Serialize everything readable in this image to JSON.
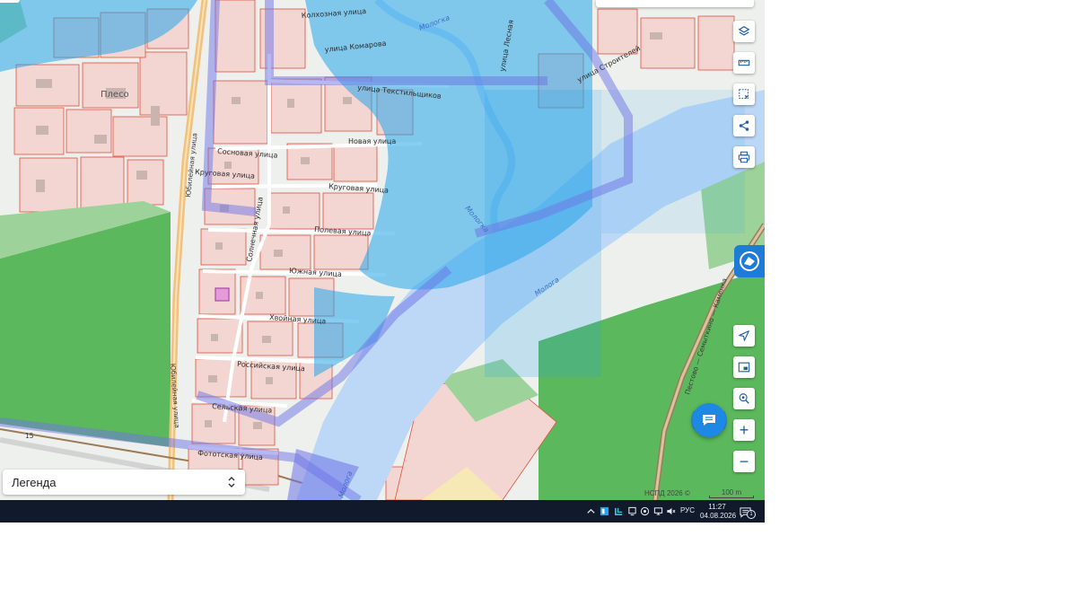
{
  "map": {
    "labels": {
      "town": "Плесо",
      "komarova": "улица Комарова",
      "tekstilshchikov": "улица Текстильщиков",
      "kolkhoznaya": "Колхозная улица",
      "stroiteley": "улица Строителей",
      "lesnaya": "улица Лесная",
      "novaya": "Новая улица",
      "sosnovaya": "Сосновая улица",
      "krugovaya_west": "Круговая улица",
      "krugovaya_east": "Круговая улица",
      "yubileynaya_north": "Юбилейная улица",
      "yubileynaya_south": "Юбилейная улица",
      "solnechnaya": "Солнечная улица",
      "polevaya": "Полевая улица",
      "yuzhnaya": "Южная улица",
      "khvoynaya": "Хвойная улица",
      "rossiyskaya": "Российская улица",
      "selskaya": "Сельская улица",
      "fototskaya": "Фототская улица",
      "mologa_center": "Молога",
      "mologa_south": "Молога",
      "molojka_north": "Мологка",
      "molojka_mid": "Мологка",
      "road_east": "Пестово — Семыткино — Каменка",
      "road_number": "15"
    },
    "colors": {
      "background": "#eef0ee",
      "parcel_fill": "#f3d6d2",
      "parcel_stroke": "#e0503a",
      "green": "#5cb85c",
      "light_green": "#9dd39a",
      "water": "#bdd7f7",
      "flood_blue": "#25a6ea",
      "protection_purple": "#6e73e6",
      "road": "#ffffff",
      "federal_road": "#f3c27a",
      "rail": "#9c7b57"
    }
  },
  "controls": {
    "layers": "layers-icon",
    "ruler": "ruler-icon",
    "select_area": "select-area-icon",
    "share": "share-icon",
    "print": "printer-icon",
    "locate": "locate-arrow-icon",
    "minimap": "minimap-icon",
    "geo_search": "geo-search-icon",
    "zoom_in": "+",
    "zoom_out": "−",
    "chat": "chat-icon",
    "logo": "nspd-logo-icon"
  },
  "legend": {
    "label": "Легенда"
  },
  "attribution": "НСПД 2026 ©",
  "scale": {
    "label": "100 m"
  },
  "taskbar": {
    "language": "РУС",
    "time": "11:27",
    "date": "04.08.2026",
    "notifications": "1",
    "tray_icons": [
      "chevron-up-icon",
      "cloud-app-icon",
      "vpn-icon",
      "display-icon",
      "wifi-icon",
      "network-icon",
      "mute-icon"
    ]
  }
}
